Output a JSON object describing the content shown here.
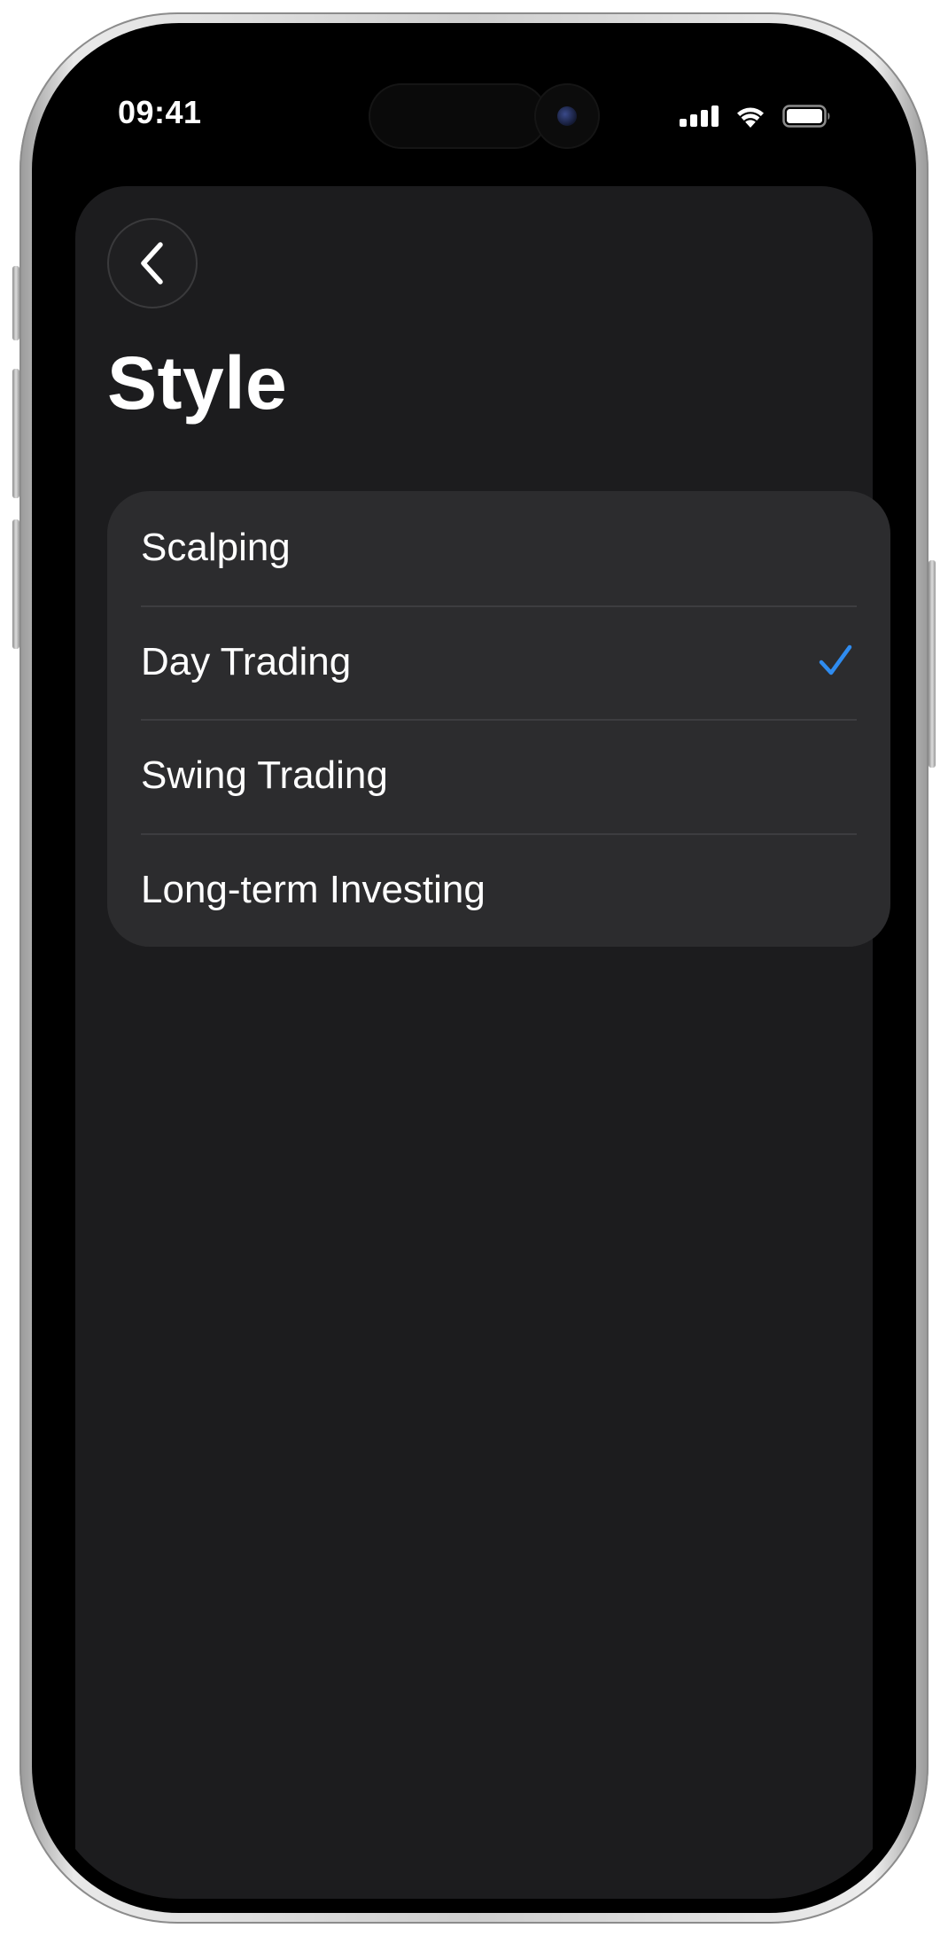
{
  "status_bar": {
    "time": "09:41",
    "icons": [
      "cellular-signal-icon",
      "wifi-icon",
      "battery-icon"
    ]
  },
  "navigation": {
    "back_icon": "chevron-left-icon"
  },
  "page": {
    "title": "Style"
  },
  "style_options": [
    {
      "label": "Scalping",
      "selected": false
    },
    {
      "label": "Day Trading",
      "selected": true
    },
    {
      "label": "Swing Trading",
      "selected": false
    },
    {
      "label": "Long-term Investing",
      "selected": false
    }
  ],
  "colors": {
    "accent": "#2f8cf0",
    "background": "#1c1c1e",
    "group_background": "#2c2c2e",
    "text": "#ffffff"
  }
}
